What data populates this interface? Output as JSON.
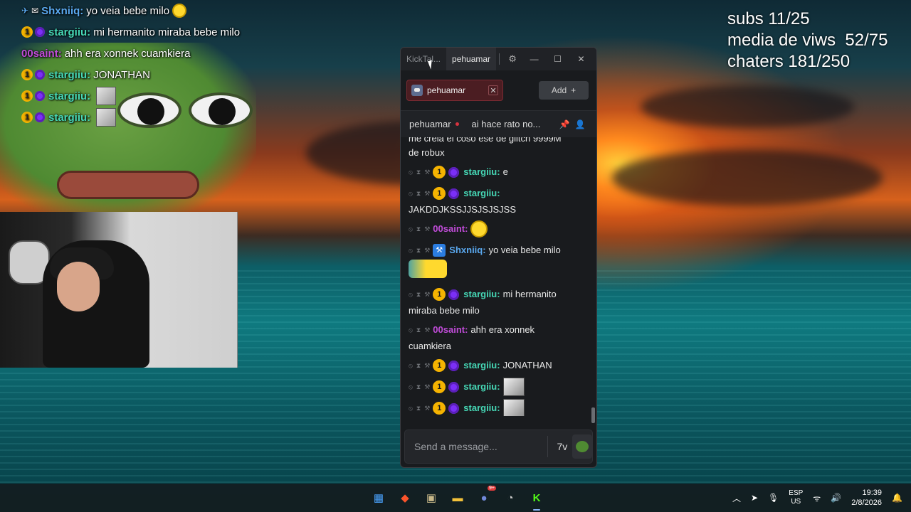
{
  "overlay_chat": [
    {
      "badges": [
        "pin",
        "mail"
      ],
      "user": "Shxniiq:",
      "user_color": "#5aa9f0",
      "text": "yo veia bebe milo",
      "emote": "yellow"
    },
    {
      "badges": [
        "sub",
        "purple"
      ],
      "user": "stargiiu:",
      "user_color": "#46d8b6",
      "text": "mi hermanito miraba bebe milo"
    },
    {
      "badges": [],
      "user": "00saint:",
      "user_color": "#c04cd8",
      "text": "ahh era xonnek cuamkiera"
    },
    {
      "badges": [
        "sub",
        "purple"
      ],
      "user": "stargiiu:",
      "user_color": "#46d8b6",
      "text": "JONATHAN"
    },
    {
      "badges": [
        "sub",
        "purple"
      ],
      "user": "stargiiu:",
      "user_color": "#46d8b6",
      "text": "",
      "image": true
    },
    {
      "badges": [
        "sub",
        "purple"
      ],
      "user": "stargiiu:",
      "user_color": "#46d8b6",
      "text": "",
      "image": true
    }
  ],
  "stats": {
    "subs": "subs 11/25",
    "views": "media de viws  52/75",
    "chatters": "chaters 181/250"
  },
  "window": {
    "tabs": [
      "KickTal...",
      "pehuamar"
    ],
    "channel_chip": "pehuamar",
    "add_label": "Add",
    "stream_user": "pehuamar",
    "stream_title": "ai hace rato no...",
    "partial_message": {
      "line1": "me creia el coso ese de glitch 9999M",
      "line2": "de robux"
    },
    "messages": [
      {
        "user": "stargiiu:",
        "color": "teal",
        "badges": [
          "sub",
          "purple"
        ],
        "text": "e"
      },
      {
        "user": "stargiiu:",
        "color": "teal",
        "badges": [
          "sub",
          "purple"
        ],
        "text": "",
        "cont": "JAKDDJKSSJJSJSJSJSS"
      },
      {
        "user": "00saint:",
        "color": "pink",
        "badges": [],
        "text": "",
        "emoji": true
      },
      {
        "user": "Shxniiq:",
        "color": "blue",
        "badges": [
          "pin"
        ],
        "text": "yo veia bebe milo",
        "emote_big": true
      },
      {
        "user": "stargiiu:",
        "color": "teal",
        "badges": [
          "sub",
          "purple"
        ],
        "text": "mi hermanito",
        "cont": "miraba bebe milo"
      },
      {
        "user": "00saint:",
        "color": "pink",
        "badges": [],
        "text": "ahh era xonnek",
        "cont": "cuamkiera"
      },
      {
        "user": "stargiiu:",
        "color": "teal",
        "badges": [
          "sub",
          "purple"
        ],
        "text": "JONATHAN"
      },
      {
        "user": "stargiiu:",
        "color": "teal",
        "badges": [
          "sub",
          "purple"
        ],
        "text": "",
        "image": true
      },
      {
        "user": "stargiiu:",
        "color": "teal",
        "badges": [
          "sub",
          "purple"
        ],
        "text": "",
        "image": true
      }
    ],
    "input_placeholder": "Send a message..."
  },
  "taskbar": {
    "apps": [
      "windows-start",
      "brave",
      "browser-app",
      "file-explorer",
      "discord",
      "app-clock",
      "kick"
    ],
    "discord_badge": "9+",
    "lang_top": "ESP",
    "lang_bottom": "US",
    "time": "19:39",
    "date": "2/8/2026"
  },
  "colors": {
    "accent_kick": "#53fc18",
    "teal": "#46d8b6",
    "pink": "#c04cd8",
    "blue": "#5aa9f0"
  }
}
